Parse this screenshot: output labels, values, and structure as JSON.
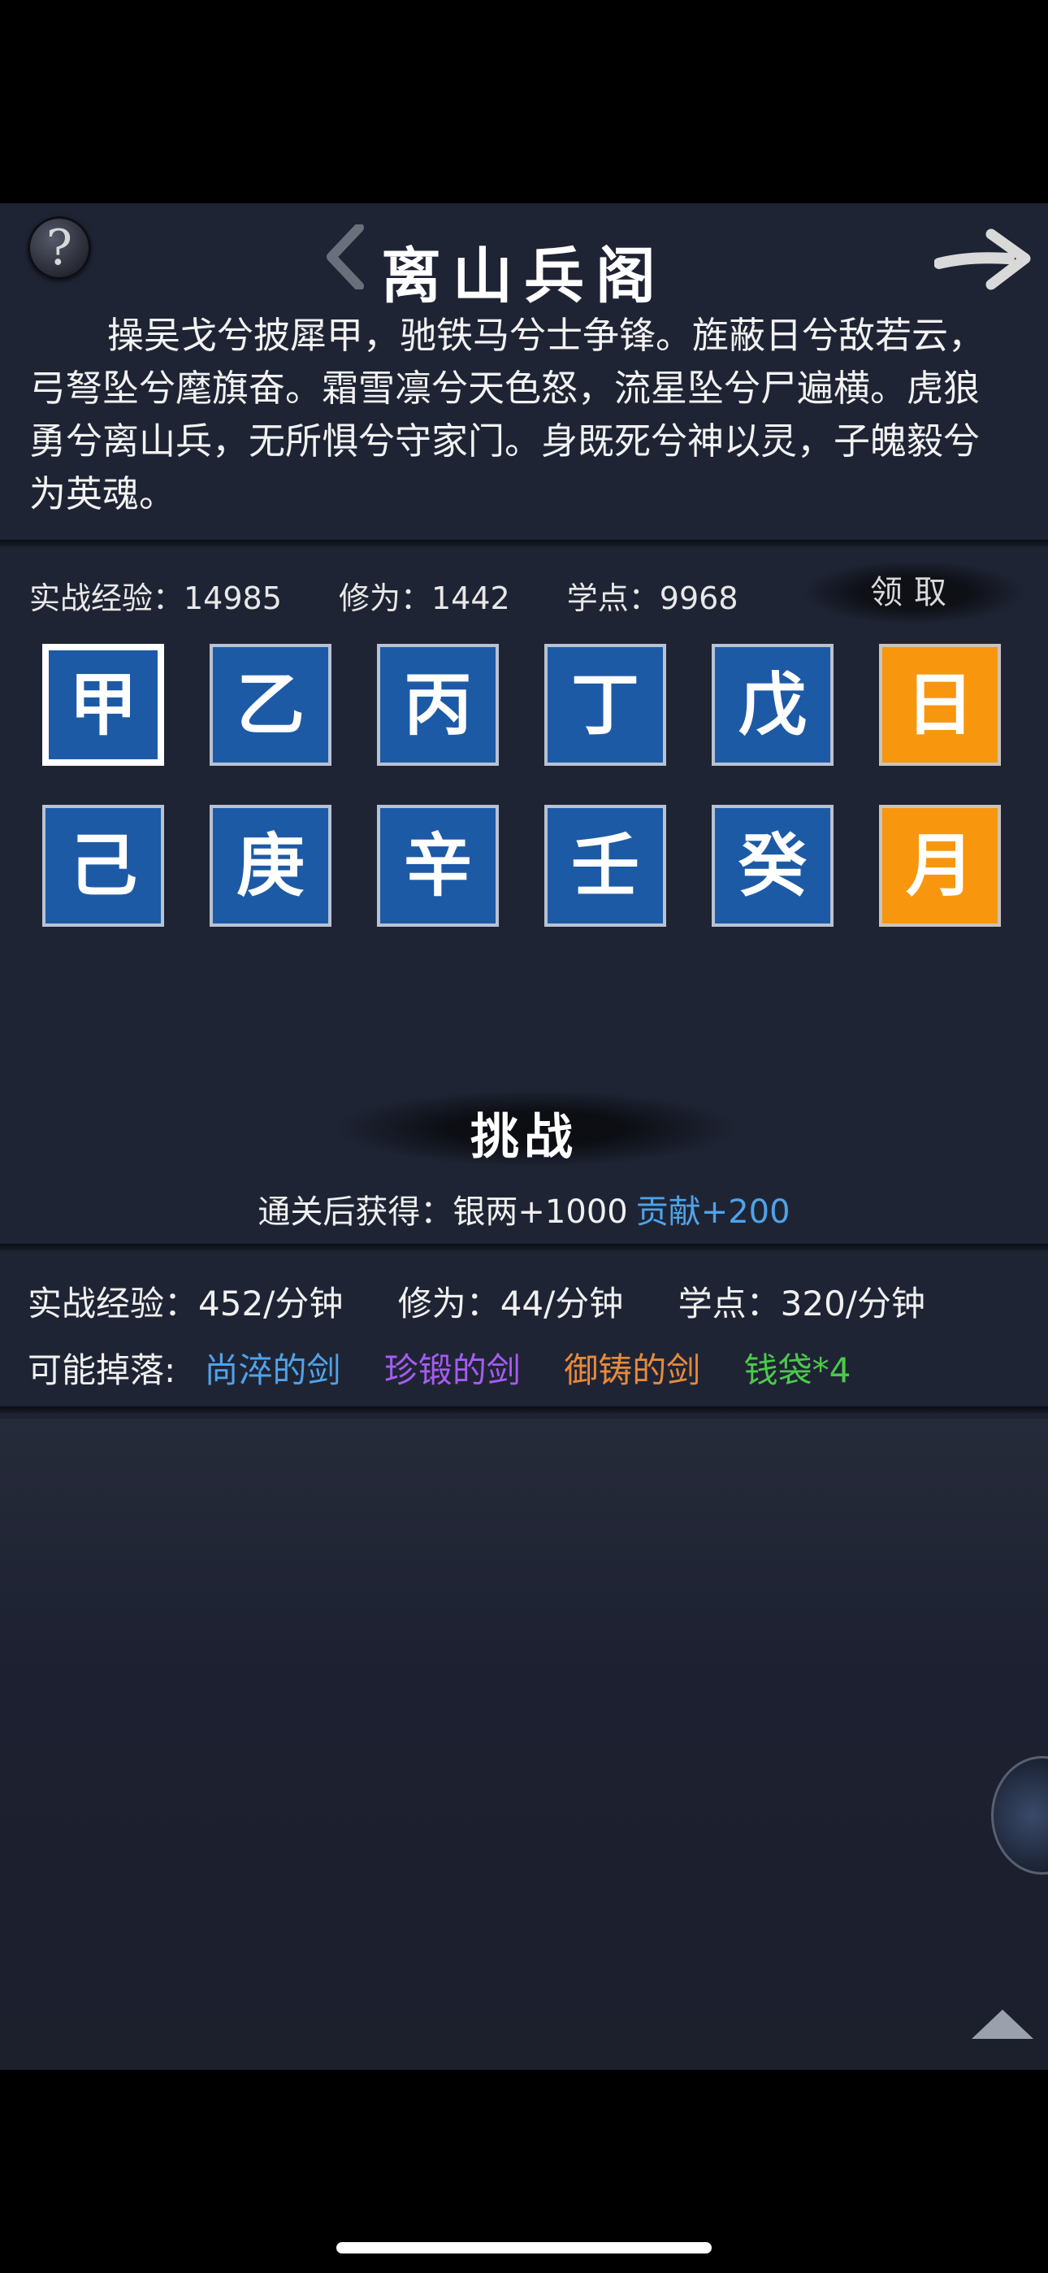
{
  "header": {
    "title": "离山兵阁",
    "help_icon": "help-icon",
    "back_icon": "chevron-left-icon",
    "next_icon": "arrow-right-icon"
  },
  "intro": "操吴戈兮披犀甲，驰铁马兮士争锋。旌蔽日兮敌若云，弓弩坠兮麾旗奋。霜雪凛兮天色怒，流星坠兮尸遍横。虎狼勇兮离山兵，无所惧兮守家门。身既死兮神以灵，子魄毅兮为英魂。",
  "stats": {
    "exp": "实战经验：14985",
    "cultivation": "修为：1442",
    "points": "学点：9968",
    "claim": "领取"
  },
  "tiles": [
    {
      "label": "甲"
    },
    {
      "label": "乙"
    },
    {
      "label": "丙"
    },
    {
      "label": "丁"
    },
    {
      "label": "戊"
    },
    {
      "label": "日"
    },
    {
      "label": "己"
    },
    {
      "label": "庚"
    },
    {
      "label": "辛"
    },
    {
      "label": "壬"
    },
    {
      "label": "癸"
    },
    {
      "label": "月"
    }
  ],
  "colors": {
    "tile_blue": "#1d5aa6",
    "tile_gold": "#f8970e",
    "reward_blue": "#4fa3e8",
    "drop_blue": "#4fa3e8",
    "drop_purple": "#a55cf0",
    "drop_orange": "#e68a3c",
    "drop_green": "#4cc94c"
  },
  "challenge": {
    "label": "挑战",
    "reward_prefix": "通关后获得：银两+1000",
    "reward_bonus": "贡献+200"
  },
  "rates": {
    "exp": "实战经验：452/分钟",
    "cultivation": "修为：44/分钟",
    "points": "学点：320/分钟"
  },
  "drops": {
    "label": "可能掉落:",
    "items": [
      "尚淬的剑",
      "珍锻的剑",
      "御铸的剑",
      "钱袋*4"
    ]
  }
}
